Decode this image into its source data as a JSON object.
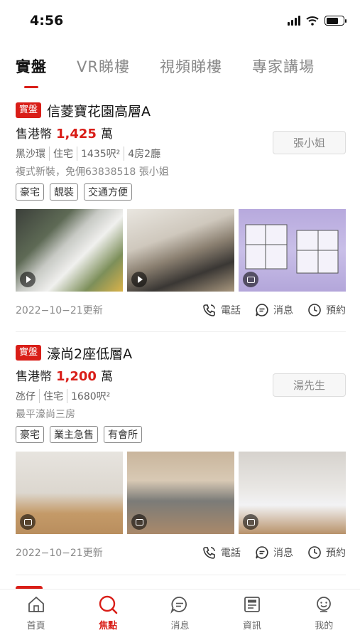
{
  "status": {
    "time": "4:56"
  },
  "tabs": [
    {
      "label": "實盤",
      "active": true
    },
    {
      "label": "VR睇樓",
      "active": false
    },
    {
      "label": "視頻睇樓",
      "active": false
    },
    {
      "label": "專家講場",
      "active": false
    }
  ],
  "listings": [
    {
      "badge": "實盤",
      "title": "信菱寶花園高層A",
      "price_prefix": "售港幣",
      "price": "1,425",
      "price_unit": "萬",
      "agent": "張小姐",
      "specs": [
        "黑沙環",
        "住宅",
        "1435呎²",
        "4房2廳"
      ],
      "description": "複式新裝，免佣63838518 張小姐",
      "tags": [
        "豪宅",
        "靚裝",
        "交通方便"
      ],
      "date": "2022−10−21更新",
      "actions": {
        "call": "電話",
        "message": "消息",
        "book": "預約"
      }
    },
    {
      "badge": "實盤",
      "title": "濠尚2座低層A",
      "price_prefix": "售港幣",
      "price": "1,200",
      "price_unit": "萬",
      "agent": "湯先生",
      "specs": [
        "氹仔",
        "住宅",
        "1680呎²"
      ],
      "description": "最平濠尚三房",
      "tags": [
        "豪宅",
        "業主急售",
        "有會所"
      ],
      "date": "2022−10−21更新",
      "actions": {
        "call": "電話",
        "message": "消息",
        "book": "預約"
      }
    }
  ],
  "bottom_nav": [
    {
      "label": "首頁",
      "icon": "home-icon",
      "active": false
    },
    {
      "label": "焦點",
      "icon": "focus-icon",
      "active": true
    },
    {
      "label": "消息",
      "icon": "chat-icon",
      "active": false
    },
    {
      "label": "資訊",
      "icon": "news-icon",
      "active": false
    },
    {
      "label": "我的",
      "icon": "profile-icon",
      "active": false
    }
  ],
  "colors": {
    "accent": "#d91e18",
    "muted": "#888888"
  }
}
